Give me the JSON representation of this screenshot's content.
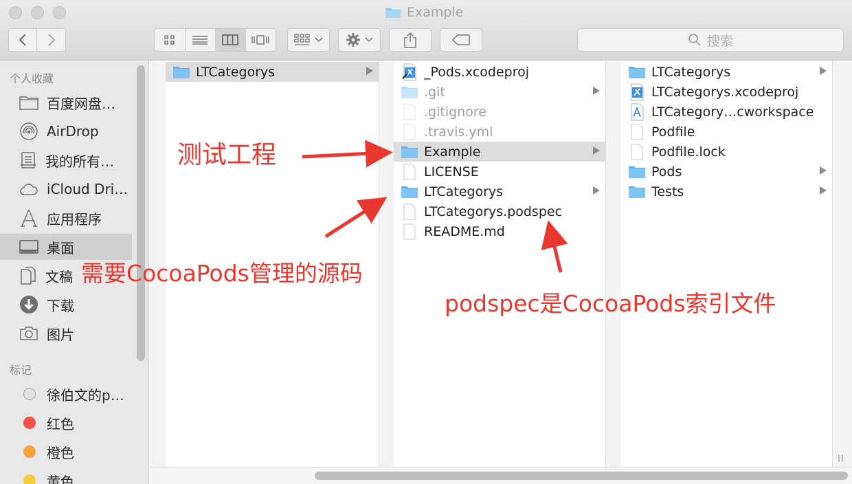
{
  "window": {
    "title": "Example"
  },
  "search": {
    "placeholder": "搜索"
  },
  "sidebar": {
    "favorites_header": "个人收藏",
    "favorites": [
      {
        "label": "百度网盘…",
        "icon": "folder-icon"
      },
      {
        "label": "AirDrop",
        "icon": "airdrop-icon"
      },
      {
        "label": "我的所有…",
        "icon": "all-files-icon"
      },
      {
        "label": "iCloud Dri…",
        "icon": "cloud-icon"
      },
      {
        "label": "应用程序",
        "icon": "applications-icon"
      },
      {
        "label": "桌面",
        "icon": "desktop-icon",
        "selected": true
      },
      {
        "label": "文稿",
        "icon": "documents-icon"
      },
      {
        "label": "下载",
        "icon": "download-icon"
      },
      {
        "label": "图片",
        "icon": "camera-icon"
      }
    ],
    "tags_header": "标记",
    "tags": [
      {
        "label": "徐伯文的p…",
        "color": "#e2e2e2"
      },
      {
        "label": "红色",
        "color": "#f4504a"
      },
      {
        "label": "橙色",
        "color": "#f7a23b"
      },
      {
        "label": "黄色",
        "color": "#f5cd3a"
      }
    ]
  },
  "columns": [
    {
      "items": [
        {
          "name": "LTCategorys",
          "type": "folder",
          "has_children": true,
          "selected": true
        }
      ]
    },
    {
      "items": [
        {
          "name": "_Pods.xcodeproj",
          "type": "xcodeproj",
          "has_children": false
        },
        {
          "name": ".git",
          "type": "folder-dim",
          "has_children": true,
          "dim": true
        },
        {
          "name": ".gitignore",
          "type": "file-dim",
          "has_children": false,
          "dim": true
        },
        {
          "name": ".travis.yml",
          "type": "file-dim",
          "has_children": false,
          "dim": true
        },
        {
          "name": "Example",
          "type": "folder",
          "has_children": true,
          "selected": true
        },
        {
          "name": "LICENSE",
          "type": "file",
          "has_children": false
        },
        {
          "name": "LTCategorys",
          "type": "folder",
          "has_children": true
        },
        {
          "name": "LTCategorys.podspec",
          "type": "file",
          "has_children": false
        },
        {
          "name": "README.md",
          "type": "file",
          "has_children": false
        }
      ]
    },
    {
      "items": [
        {
          "name": "LTCategorys",
          "type": "folder",
          "has_children": true
        },
        {
          "name": "LTCategorys.xcodeproj",
          "type": "xcodeproj",
          "has_children": false
        },
        {
          "name": "LTCategory…cworkspace",
          "type": "xcworkspace",
          "has_children": false
        },
        {
          "name": "Podfile",
          "type": "file",
          "has_children": false
        },
        {
          "name": "Podfile.lock",
          "type": "file",
          "has_children": false
        },
        {
          "name": "Pods",
          "type": "folder",
          "has_children": true
        },
        {
          "name": "Tests",
          "type": "folder",
          "has_children": true
        }
      ]
    }
  ],
  "annotations": {
    "test_project": "测试工程",
    "source_code": "需要CocoaPods管理的源码",
    "podspec_note": "podspec是CocoaPods索引文件"
  },
  "colors": {
    "annotation": "#e8372f",
    "folder": "#67b9f2",
    "selection": "#dcdcdc"
  }
}
